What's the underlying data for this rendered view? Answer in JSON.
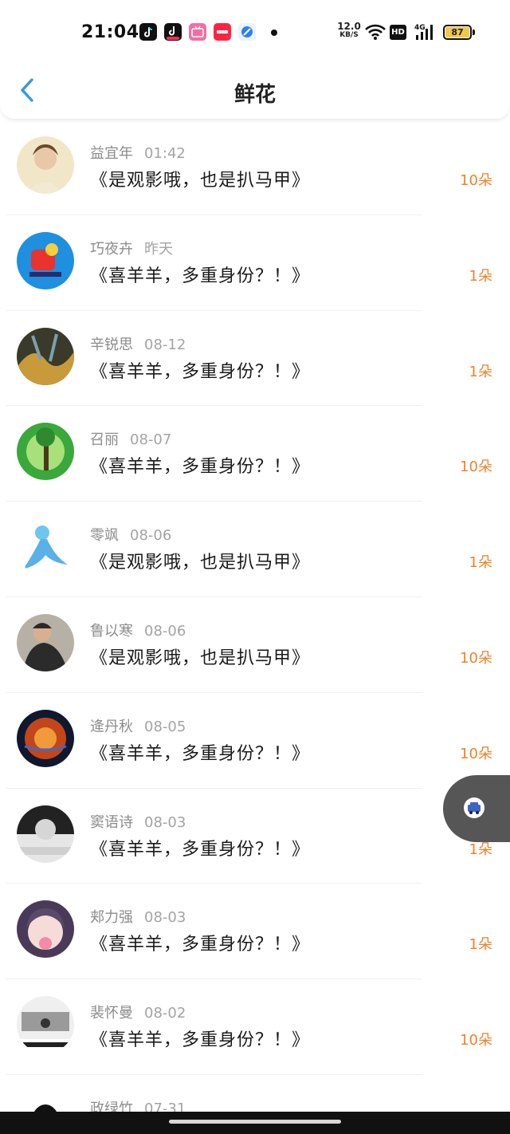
{
  "status_bar": {
    "time": "21:04",
    "net_speed": "12.0",
    "net_unit": "KB/S",
    "hd_label": "HD",
    "network_label": "4G",
    "battery": "87",
    "app_icons": [
      "tiktok-icon",
      "tiktok-live-icon",
      "bilibili-icon",
      "xiaohongshu-icon",
      "browser-icon"
    ]
  },
  "header": {
    "title": "鲜花"
  },
  "rows": [
    {
      "name": "益宜年",
      "date": "01:42",
      "message": "《是观影哦，也是扒马甲》",
      "flowers": "10朵"
    },
    {
      "name": "巧夜卉",
      "date": "昨天",
      "message": "《喜羊羊，多重身份？！》",
      "flowers": "1朵"
    },
    {
      "name": "辛锐思",
      "date": "08-12",
      "message": "《喜羊羊，多重身份？！》",
      "flowers": "1朵"
    },
    {
      "name": "召丽",
      "date": "08-07",
      "message": "《喜羊羊，多重身份？！》",
      "flowers": "10朵"
    },
    {
      "name": "零飒",
      "date": "08-06",
      "message": "《是观影哦，也是扒马甲》",
      "flowers": "1朵"
    },
    {
      "name": "鲁以寒",
      "date": "08-06",
      "message": "《是观影哦，也是扒马甲》",
      "flowers": "10朵"
    },
    {
      "name": "逄丹秋",
      "date": "08-05",
      "message": "《喜羊羊，多重身份？！》",
      "flowers": "10朵"
    },
    {
      "name": "窦语诗",
      "date": "08-03",
      "message": "《喜羊羊，多重身份？！》",
      "flowers": "1朵"
    },
    {
      "name": "郏力强",
      "date": "08-03",
      "message": "《喜羊羊，多重身份？！》",
      "flowers": "1朵"
    },
    {
      "name": "裴怀曼",
      "date": "08-02",
      "message": "《喜羊羊，多重身份？！》",
      "flowers": "10朵"
    },
    {
      "name": "政绿竹",
      "date": "07-31",
      "message": "",
      "flowers": ""
    }
  ],
  "colors": {
    "accent": "#2f9be8",
    "flowers": "#f0812a",
    "float_button": "#565656"
  }
}
